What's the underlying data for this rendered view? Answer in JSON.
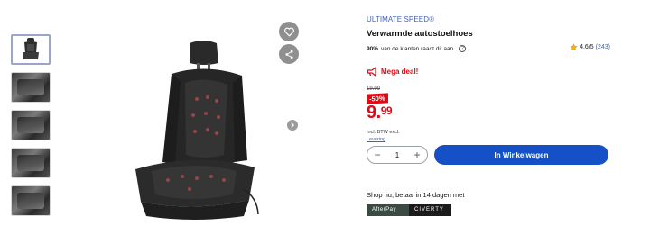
{
  "thumbnails": [
    {
      "name": "thumb-seat-cover"
    },
    {
      "name": "thumb-car-interior-1"
    },
    {
      "name": "thumb-car-interior-2"
    },
    {
      "name": "thumb-car-interior-3"
    },
    {
      "name": "thumb-car-interior-4"
    }
  ],
  "icons": {
    "favorite": "heart-icon",
    "share": "share-icon",
    "next": "chevron-right-icon",
    "deal": "megaphone-icon",
    "info": "info-icon",
    "star": "star-icon"
  },
  "product": {
    "brand": "ULTIMATE SPEED®",
    "title": "Verwarmde autostoelhoes",
    "recommend_percent": "90%",
    "recommend_text": "van de klanten raadt dit aan",
    "info_glyph": "?",
    "rating": "4.6/5",
    "rating_count": "(243)"
  },
  "deal": {
    "label": "Mega deal!"
  },
  "price": {
    "old": "19.99",
    "discount": "-50%",
    "current_main": "9.",
    "current_cents": "99",
    "note": "Incl. BTW excl.",
    "shipping_link": "Levering"
  },
  "cart": {
    "quantity": "1",
    "minus": "−",
    "plus": "+",
    "button_label": "In Winkelwagen"
  },
  "payment": {
    "heading": "Shop nu, betaal in 14 dagen met",
    "providers": [
      "AfterPay",
      "CIVERTY"
    ]
  },
  "colors": {
    "accent": "#1550c6",
    "deal_red": "#e10915",
    "link_blue": "#3f63b8"
  }
}
